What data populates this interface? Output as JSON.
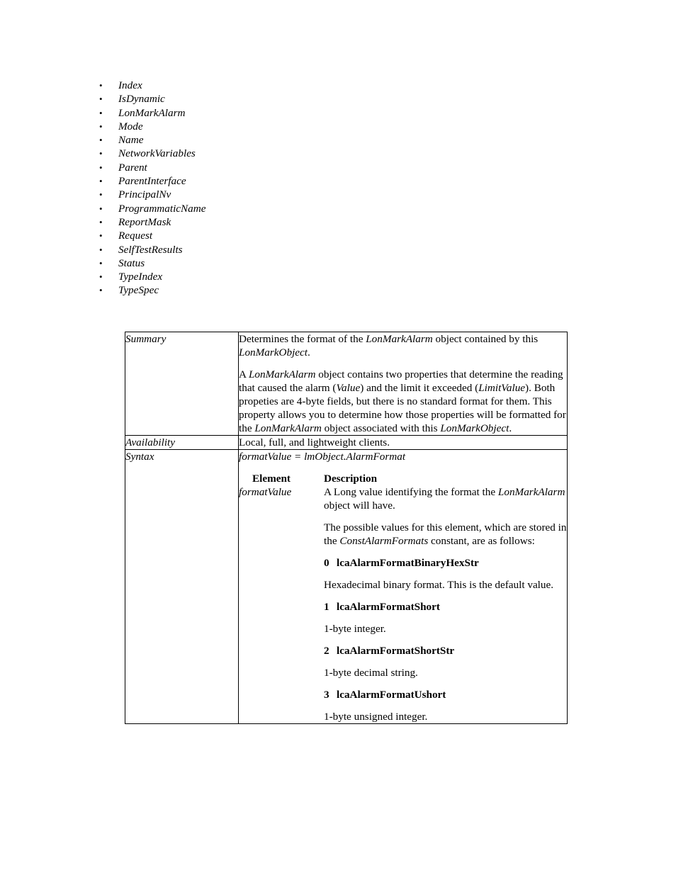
{
  "property_list": {
    "items": [
      "Index",
      "IsDynamic",
      "LonMarkAlarm",
      "Mode",
      "Name",
      "NetworkVariables",
      "Parent",
      "ParentInterface",
      "PrincipalNv",
      "ProgrammaticName",
      "ReportMask",
      "Request",
      "SelfTestResults",
      "Status",
      "TypeIndex",
      "TypeSpec"
    ]
  },
  "reference_table": {
    "summary": {
      "label": "Summary",
      "paragraph_1_a": "Determines the format of the ",
      "paragraph_1_b": "LonMarkAlarm",
      "paragraph_1_c": " object contained by this ",
      "paragraph_1_d": "LonMarkObject",
      "paragraph_1_e": ".",
      "paragraph_2_a": "A ",
      "paragraph_2_b": "LonMarkAlarm",
      "paragraph_2_c": " object contains two properties that determine the reading that caused the alarm (",
      "paragraph_2_d": "Value",
      "paragraph_2_e": ") and the limit it exceeded (",
      "paragraph_2_f": "LimitValue",
      "paragraph_2_g": ").  Both propeties are 4-byte fields, but there is no standard format for them.  This property allows you to determine how those properties will be formatted for the ",
      "paragraph_2_h": "LonMarkAlarm",
      "paragraph_2_i": " object associated with this ",
      "paragraph_2_j": "LonMarkObject",
      "paragraph_2_k": "."
    },
    "availability": {
      "label": "Availability",
      "text": "Local, full, and lightweight clients."
    },
    "syntax": {
      "label": "Syntax",
      "signature": "formatValue = lmObject.AlarmFormat",
      "header_element": "Element",
      "header_description": "Description",
      "element_name": "formatValue",
      "desc_1_a": "A Long value identifying the format the ",
      "desc_1_b": "LonMarkAlarm",
      "desc_1_c": " object will have.",
      "desc_2_a": "The possible values for this element, which are stored in the ",
      "desc_2_b": "ConstAlarmFormats",
      "desc_2_c": " constant, are as follows:",
      "constants": [
        {
          "value": "0",
          "name": "lcaAlarmFormatBinaryHexStr",
          "description": "Hexadecimal binary format. This is the default value."
        },
        {
          "value": "1",
          "name": "lcaAlarmFormatShort",
          "description": "1-byte integer."
        },
        {
          "value": "2",
          "name": "lcaAlarmFormatShortStr",
          "description": "1-byte decimal string."
        },
        {
          "value": "3",
          "name": "lcaAlarmFormatUshort",
          "description": "1-byte unsigned integer."
        }
      ]
    }
  }
}
